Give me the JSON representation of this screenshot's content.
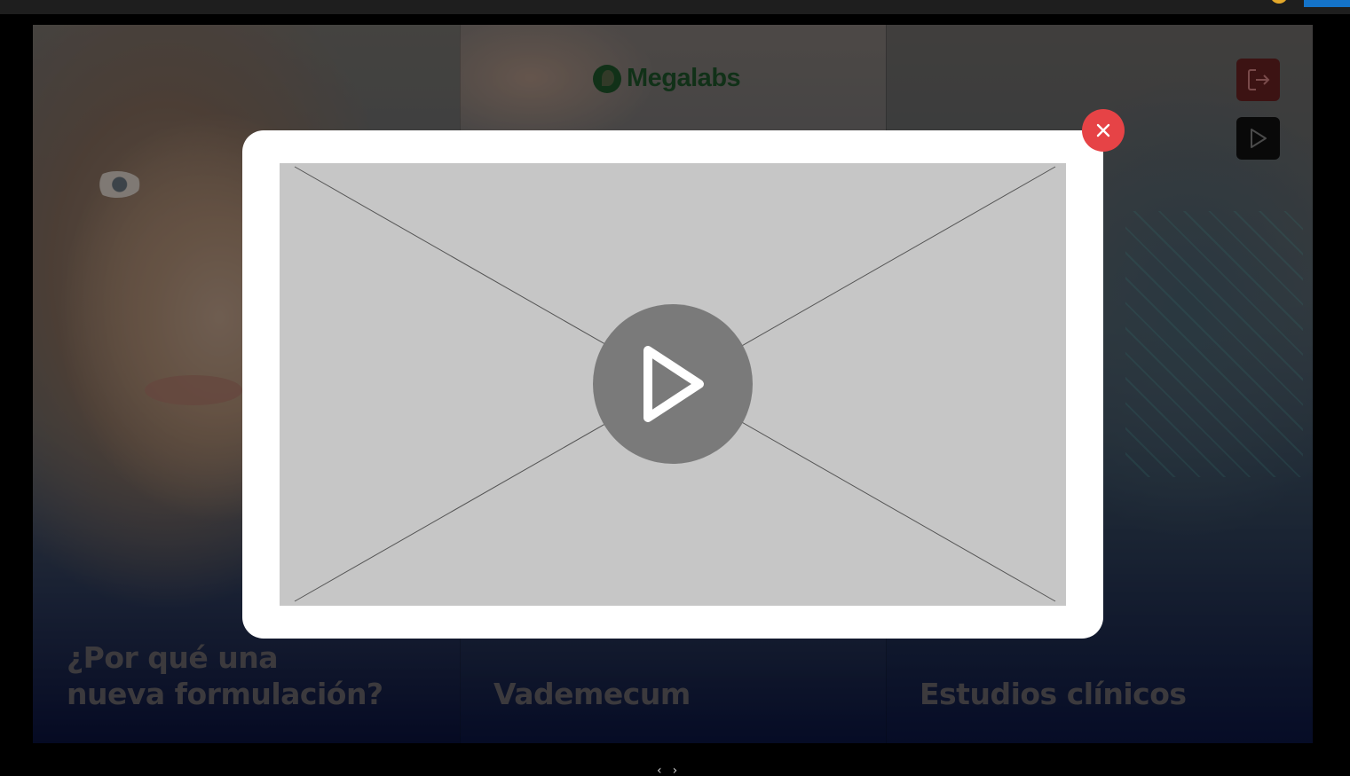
{
  "colors": {
    "brand_green": "#1f5a2c",
    "close_red": "#e64346",
    "exit_button": "#6e2424",
    "play_button": "#111111",
    "title_text": "#6d6a70"
  },
  "header": {
    "logo_text": "Megalabs",
    "logo_icon": "megalabs-leaf-icon"
  },
  "side_buttons": {
    "exit_icon": "exit-icon",
    "play_icon": "play-icon"
  },
  "panels": [
    {
      "title_line1": "¿Por qué una",
      "title_line2": "nueva formulación?"
    },
    {
      "title": "Vademecum"
    },
    {
      "title": "Estudios clínicos"
    }
  ],
  "modal": {
    "close_icon": "close-icon",
    "video_play_icon": "play-icon"
  },
  "pager": {
    "prev": "‹",
    "next": "›"
  }
}
